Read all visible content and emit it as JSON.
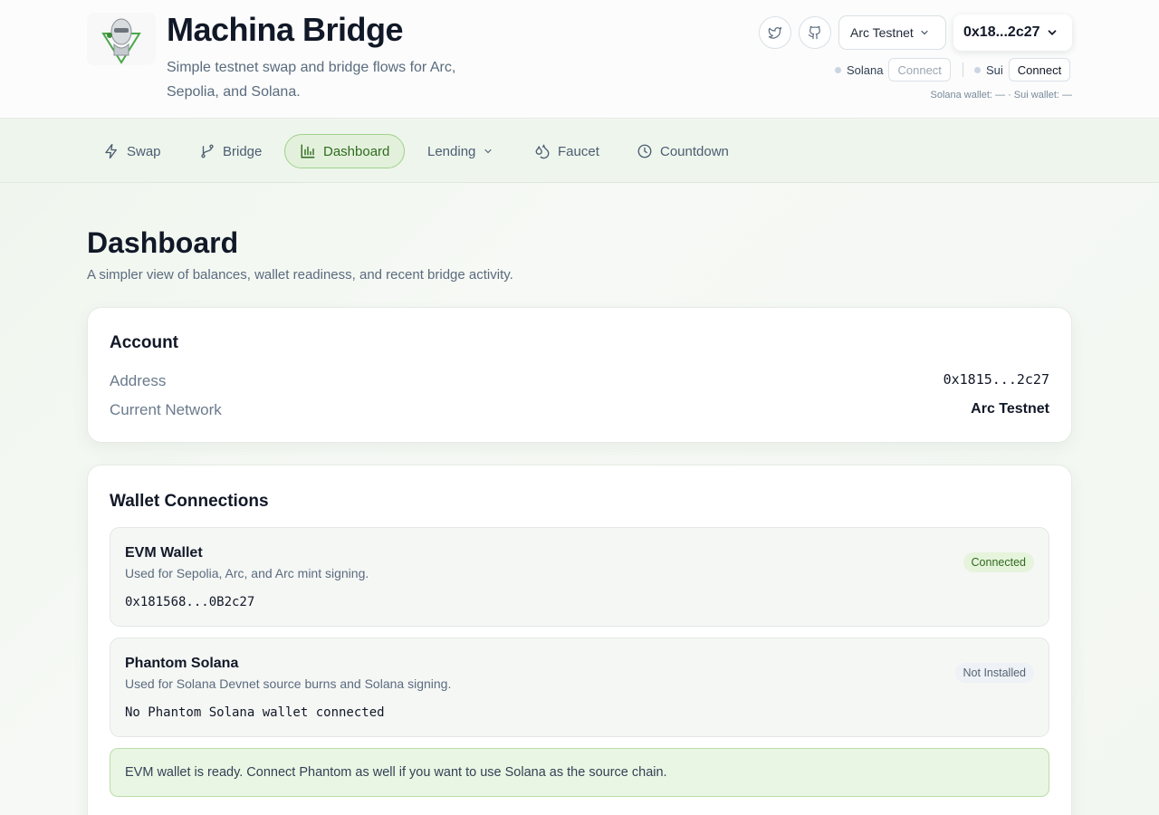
{
  "header": {
    "title": "Machina Bridge",
    "subtitle": "Simple testnet swap and bridge flows for Arc, Sepolia, and Solana.",
    "network_select": "Arc Testnet",
    "wallet_button": "0x18...2c27",
    "solana": {
      "label": "Solana",
      "button": "Connect"
    },
    "sui": {
      "label": "Sui",
      "button": "Connect"
    },
    "wallet_meta": "Solana wallet: — · Sui wallet: —"
  },
  "nav": {
    "items": [
      {
        "label": "Swap",
        "icon": "bolt-icon"
      },
      {
        "label": "Bridge",
        "icon": "branch-icon"
      },
      {
        "label": "Dashboard",
        "icon": "bar-chart-icon",
        "active": true
      },
      {
        "label": "Lending",
        "icon": "chevron-down-icon"
      },
      {
        "label": "Faucet",
        "icon": "droplets-icon"
      },
      {
        "label": "Countdown",
        "icon": "clock-icon"
      }
    ]
  },
  "main": {
    "title": "Dashboard",
    "subtitle": "A simpler view of balances, wallet readiness, and recent bridge activity."
  },
  "account": {
    "title": "Account",
    "address_label": "Address",
    "address_value": "0x1815...2c27",
    "network_label": "Current Network",
    "network_value": "Arc Testnet"
  },
  "wallets": {
    "title": "Wallet Connections",
    "evm": {
      "name": "EVM Wallet",
      "desc": "Used for Sepolia, Arc, and Arc mint signing.",
      "address": "0x181568...0B2c27",
      "status": "Connected"
    },
    "phantom": {
      "name": "Phantom Solana",
      "desc": "Used for Solana Devnet source burns and Solana signing.",
      "address": "No Phantom Solana wallet connected",
      "status": "Not Installed"
    },
    "notice": "EVM wallet is ready. Connect Phantom as well if you want to use Solana as the source chain."
  },
  "colors": {
    "accent": "#2f6b1f",
    "active_bg": "#e3f1dc",
    "notice_bg": "#eaf6e4"
  }
}
